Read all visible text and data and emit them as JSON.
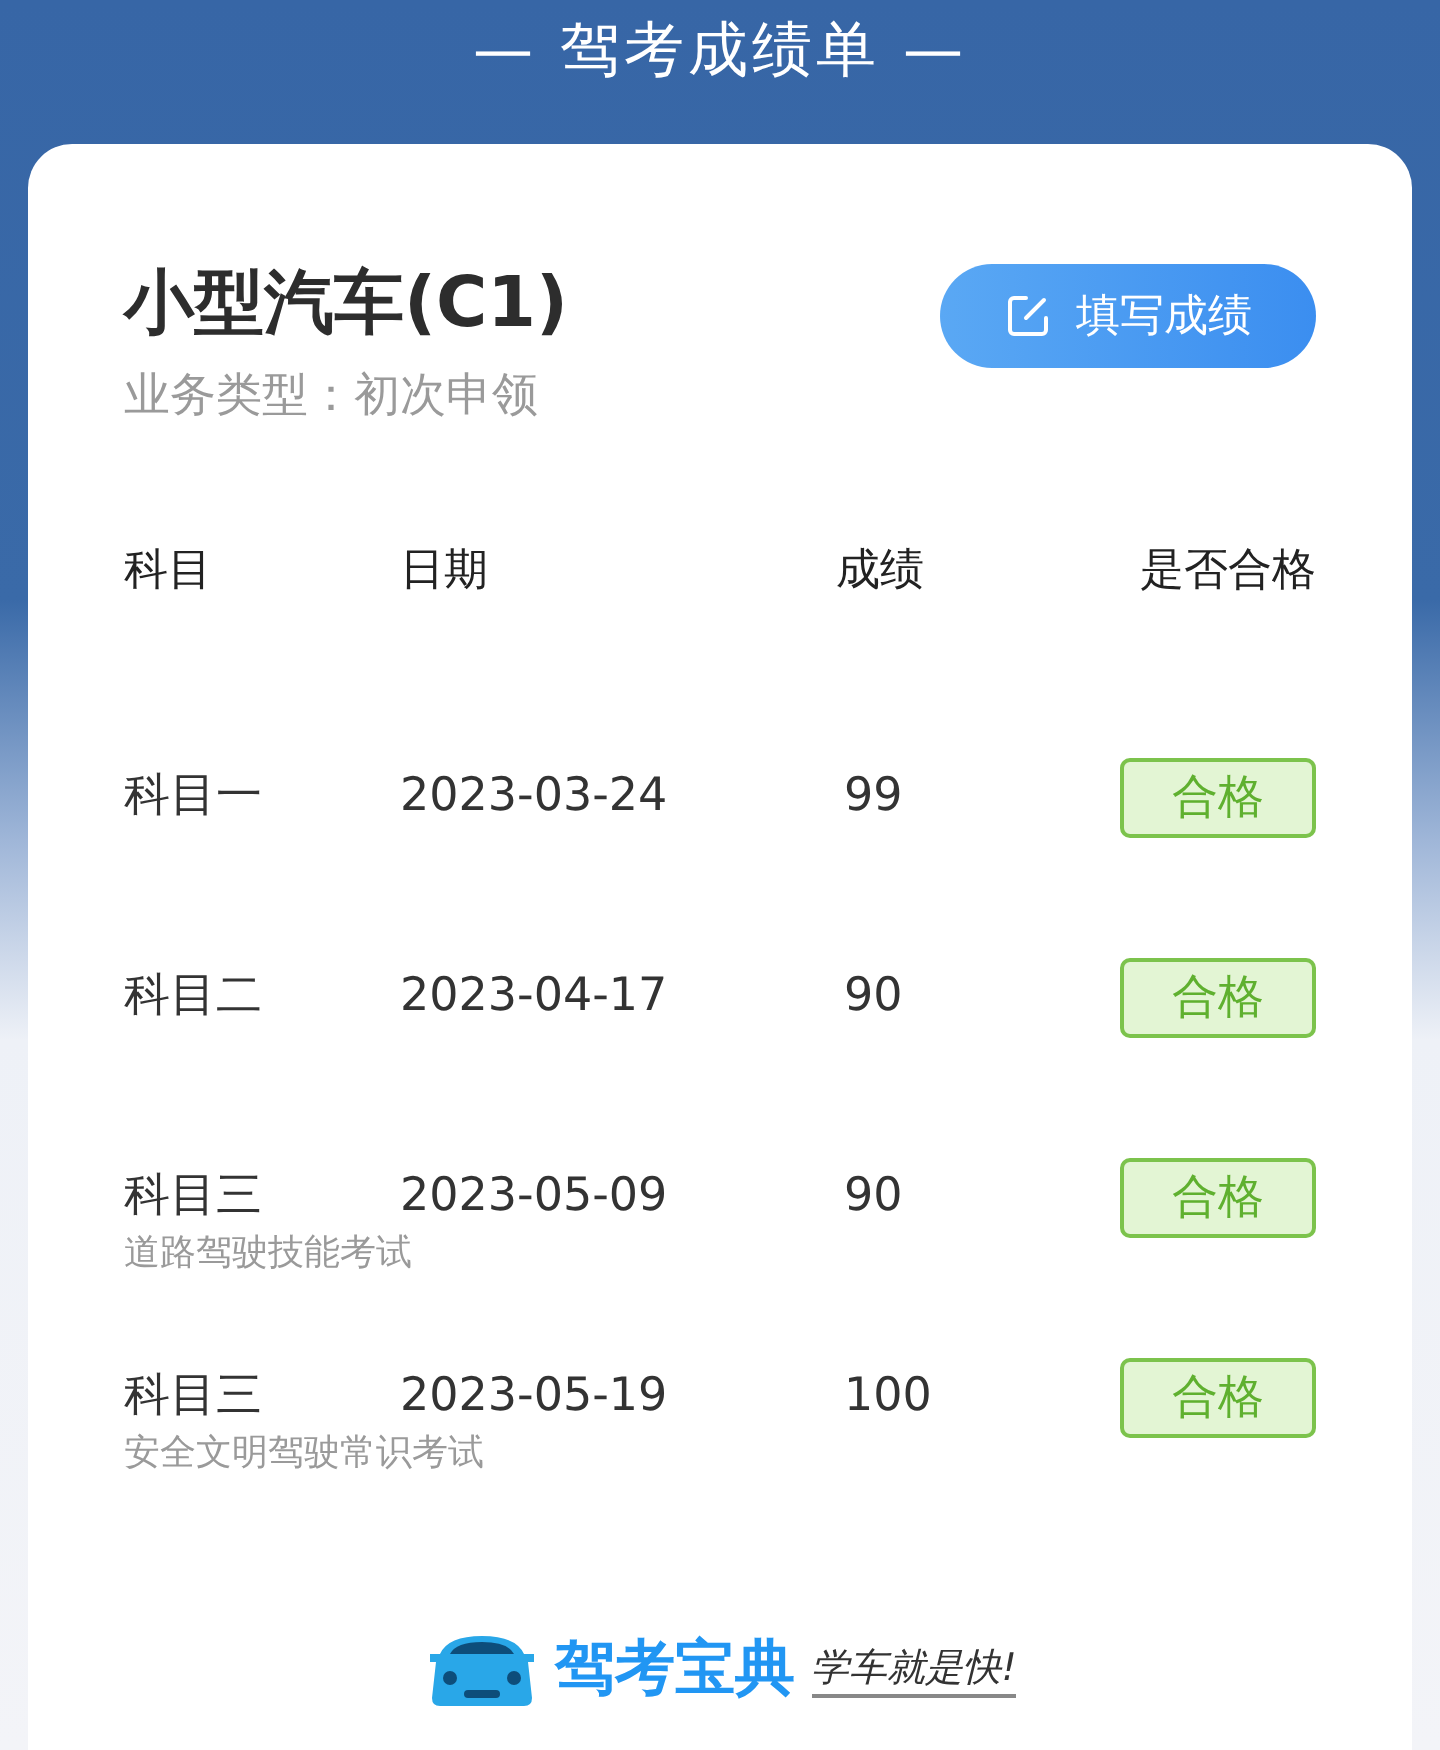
{
  "header": {
    "title": "— 驾考成绩单 —"
  },
  "card": {
    "vehicle": "小型汽车(C1)",
    "business": "业务类型：初次申领",
    "fill_button": "填写成绩",
    "columns": [
      "科目",
      "日期",
      "成绩",
      "是否合格"
    ],
    "rows": [
      {
        "subject": "科目一",
        "date": "2023-03-24",
        "score": "99",
        "result": "合格",
        "passed": true
      },
      {
        "subject": "科目二",
        "date": "2023-04-17",
        "score": "90",
        "result": "合格",
        "passed": true
      },
      {
        "subject": "科目三",
        "date": "2023-05-09",
        "score": "90",
        "result": "合格",
        "passed": true,
        "note": "道路驾驶技能考试"
      },
      {
        "subject": "科目三",
        "date": "2023-05-19",
        "score": "100",
        "result": "合格",
        "passed": true,
        "note": "安全文明驾驶常识考试"
      }
    ],
    "brand": {
      "name": "驾考宝典",
      "slogan": "学车就是快!"
    }
  }
}
